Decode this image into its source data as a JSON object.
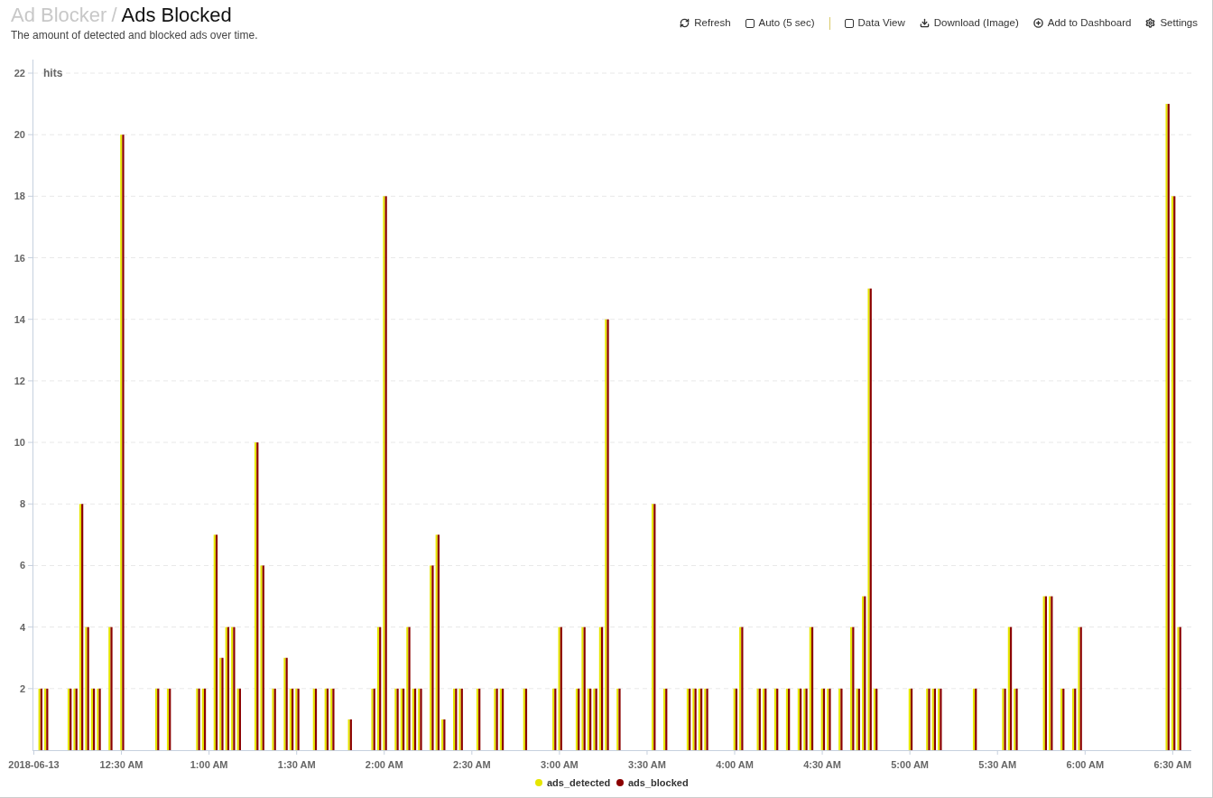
{
  "breadcrumb": {
    "parent": "Ad Blocker",
    "separator": "/",
    "current": "Ads Blocked"
  },
  "description": "The amount of detected and blocked ads over time.",
  "toolbar": [
    {
      "kind": "button",
      "label": "Refresh"
    },
    {
      "kind": "checkbox",
      "label": "Auto (5 sec)",
      "checked": false
    },
    {
      "kind": "separator"
    },
    {
      "kind": "checkbox",
      "label": "Data View",
      "checked": false
    },
    {
      "kind": "button",
      "label": "Download (Image)"
    },
    {
      "kind": "button",
      "label": "Add to Dashboard"
    },
    {
      "kind": "button",
      "label": "Settings"
    }
  ],
  "chart": {
    "chart_data": {
      "type": "bar",
      "ylabel": "hits",
      "grid": true,
      "legend": true,
      "xlim": [
        0,
        397
      ],
      "ylim": [
        0,
        22
      ],
      "x": [
        2,
        4,
        12,
        14,
        16,
        18,
        20,
        22,
        26,
        30,
        42,
        46,
        56,
        58,
        62,
        64,
        66,
        68,
        70,
        76,
        78,
        82,
        86,
        88,
        90,
        96,
        100,
        102,
        108,
        116,
        118,
        120,
        124,
        126,
        128,
        130,
        132,
        136,
        138,
        140,
        144,
        146,
        152,
        158,
        160,
        168,
        178,
        180,
        186,
        188,
        190,
        192,
        194,
        196,
        200,
        212,
        216,
        224,
        226,
        228,
        230,
        240,
        242,
        248,
        250,
        254,
        258,
        262,
        264,
        266,
        270,
        272,
        276,
        280,
        282,
        284,
        286,
        288,
        300,
        306,
        308,
        310,
        322,
        332,
        334,
        336,
        346,
        348,
        352,
        356,
        358,
        388,
        390,
        392
      ],
      "series": [
        {
          "name": "ads_detected",
          "color": "#e6e600",
          "values": [
            2,
            2,
            2,
            2,
            8,
            4,
            2,
            2,
            4,
            20,
            2,
            2,
            2,
            2,
            7,
            3,
            4,
            4,
            2,
            10,
            6,
            2,
            3,
            2,
            2,
            2,
            2,
            2,
            1,
            2,
            4,
            18,
            2,
            2,
            4,
            2,
            2,
            6,
            7,
            1,
            2,
            2,
            2,
            2,
            2,
            2,
            2,
            4,
            2,
            4,
            2,
            2,
            4,
            14,
            2,
            8,
            2,
            2,
            2,
            2,
            2,
            2,
            4,
            2,
            2,
            2,
            2,
            2,
            2,
            4,
            2,
            2,
            2,
            4,
            2,
            5,
            15,
            2,
            2,
            2,
            2,
            2,
            2,
            2,
            4,
            2,
            5,
            5,
            2,
            2,
            4,
            21,
            18,
            4
          ]
        },
        {
          "name": "ads_blocked",
          "color": "#8b0000",
          "values": [
            2,
            2,
            2,
            2,
            8,
            4,
            2,
            2,
            4,
            20,
            2,
            2,
            2,
            2,
            7,
            3,
            4,
            4,
            2,
            10,
            6,
            2,
            3,
            2,
            2,
            2,
            2,
            2,
            1,
            2,
            4,
            18,
            2,
            2,
            4,
            2,
            2,
            6,
            7,
            1,
            2,
            2,
            2,
            2,
            2,
            2,
            2,
            4,
            2,
            4,
            2,
            2,
            4,
            14,
            2,
            8,
            2,
            2,
            2,
            2,
            2,
            2,
            4,
            2,
            2,
            2,
            2,
            2,
            2,
            4,
            2,
            2,
            2,
            4,
            2,
            5,
            15,
            2,
            2,
            2,
            2,
            2,
            2,
            2,
            4,
            2,
            5,
            5,
            2,
            2,
            4,
            21,
            18,
            4
          ]
        }
      ],
      "xticks": [
        {
          "value": 0,
          "label": "2018-06-13"
        },
        {
          "value": 30,
          "label": "12:30 AM"
        },
        {
          "value": 60,
          "label": "1:00 AM"
        },
        {
          "value": 90,
          "label": "1:30 AM"
        },
        {
          "value": 120,
          "label": "2:00 AM"
        },
        {
          "value": 150,
          "label": "2:30 AM"
        },
        {
          "value": 180,
          "label": "3:00 AM"
        },
        {
          "value": 210,
          "label": "3:30 AM"
        },
        {
          "value": 240,
          "label": "4:00 AM"
        },
        {
          "value": 270,
          "label": "4:30 AM"
        },
        {
          "value": 300,
          "label": "5:00 AM"
        },
        {
          "value": 330,
          "label": "5:30 AM"
        },
        {
          "value": 360,
          "label": "6:00 AM"
        },
        {
          "value": 390,
          "label": "6:30 AM"
        }
      ],
      "yticks": [
        2,
        4,
        6,
        8,
        10,
        12,
        14,
        16,
        18,
        20,
        22
      ]
    }
  }
}
